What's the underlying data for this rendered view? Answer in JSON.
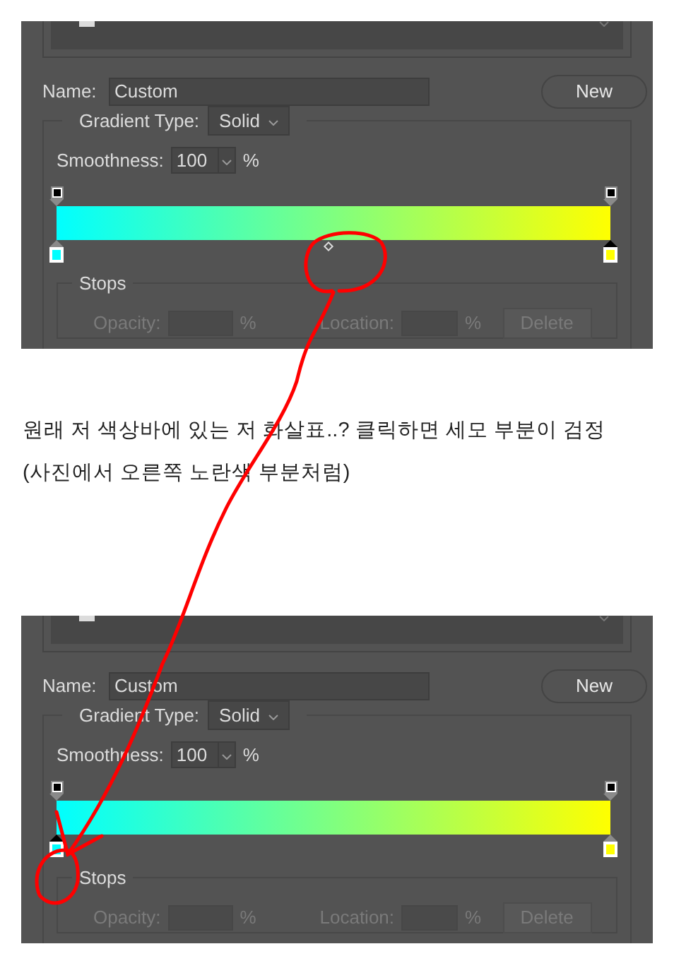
{
  "screenshots": [
    {
      "name_label": "Name:",
      "name_value": "Custom",
      "new_button": "New",
      "gradient_type_label": "Gradient Type:",
      "gradient_type": "Solid",
      "smoothness_label": "Smoothness:",
      "smoothness": "100",
      "smoothness_unit": "%",
      "opacity_stops": [
        {
          "selected": false
        },
        {
          "selected": false
        }
      ],
      "color_stops": [
        {
          "color": "#00ffff",
          "selected": false
        },
        {
          "color": "#ffff00",
          "selected": true
        }
      ],
      "midpoint_shown": true,
      "stops": {
        "title": "Stops",
        "opacity_label": "Opacity:",
        "opacity_unit": "%",
        "location_label": "Location:",
        "location_unit": "%",
        "delete_button": "Delete",
        "disabled": true
      }
    },
    {
      "name_label": "Name:",
      "name_value": "Custom",
      "new_button": "New",
      "gradient_type_label": "Gradient Type:",
      "gradient_type": "Solid",
      "smoothness_label": "Smoothness:",
      "smoothness": "100",
      "smoothness_unit": "%",
      "opacity_stops": [
        {
          "selected": false
        },
        {
          "selected": false
        }
      ],
      "color_stops": [
        {
          "color": "#00ffff",
          "selected": true
        },
        {
          "color": "#ffff00",
          "selected": false
        }
      ],
      "midpoint_shown": false,
      "stops": {
        "title": "Stops",
        "opacity_label": "Opacity:",
        "opacity_unit": "%",
        "location_label": "Location:",
        "location_unit": "%",
        "delete_button": "Delete",
        "disabled": true
      }
    }
  ],
  "post_text": [
    "원래 저 색상바에 있는 저 화살표..? 클릭하면 세모 부분이 검정",
    "(사진에서 오른쪽 노란색 부분처럼)"
  ]
}
